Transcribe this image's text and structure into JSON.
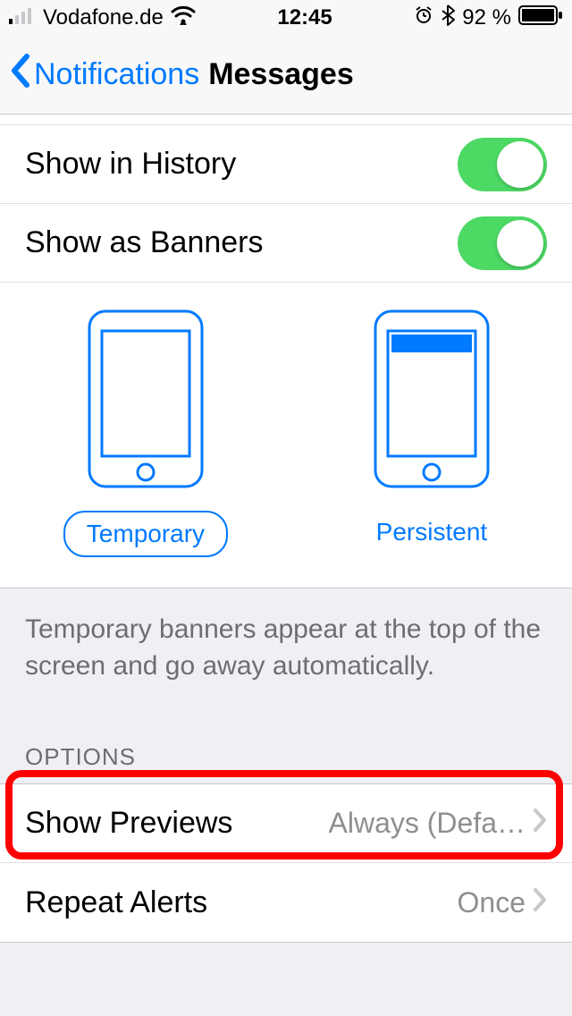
{
  "status": {
    "carrier": "Vodafone.de",
    "time": "12:45",
    "battery": "92 %"
  },
  "nav": {
    "back_label": "Notifications",
    "title": "Messages"
  },
  "rows": {
    "history": {
      "label": "Show in History",
      "on": true
    },
    "banners": {
      "label": "Show as Banners",
      "on": true
    }
  },
  "banner_styles": {
    "temporary": "Temporary",
    "persistent": "Persistent",
    "hint": "Temporary banners appear at the top of the screen and go away automatically."
  },
  "options": {
    "header": "OPTIONS",
    "previews": {
      "label": "Show Previews",
      "value": "Always (Defa…"
    },
    "repeat": {
      "label": "Repeat Alerts",
      "value": "Once"
    }
  }
}
